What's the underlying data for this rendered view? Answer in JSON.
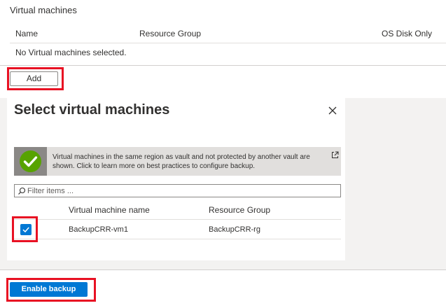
{
  "vm_panel": {
    "title": "Virtual machines",
    "columns": {
      "name": "Name",
      "resource_group": "Resource Group",
      "os_disk_only": "OS Disk Only"
    },
    "empty_message": "No Virtual machines selected."
  },
  "add_button": {
    "label": "Add"
  },
  "blade": {
    "title": "Select virtual machines",
    "close_icon": "close-icon",
    "info": {
      "icon": "checkmark-circle-icon",
      "text": "Virtual machines in the same region as vault and not protected by another vault are shown. Click to learn more on best practices to configure backup.",
      "link_icon": "external-link-icon"
    },
    "filter": {
      "placeholder": "Filter items ...",
      "value": ""
    },
    "columns": {
      "name": "Virtual machine name",
      "resource_group": "Resource Group"
    },
    "rows": [
      {
        "name": "BackupCRR-vm1",
        "resource_group": "BackupCRR-rg",
        "checked": true
      }
    ]
  },
  "footer": {
    "enable_label": "Enable backup"
  },
  "colors": {
    "accent": "#0078d4",
    "highlight": "#e81123",
    "success": "#57a300"
  }
}
